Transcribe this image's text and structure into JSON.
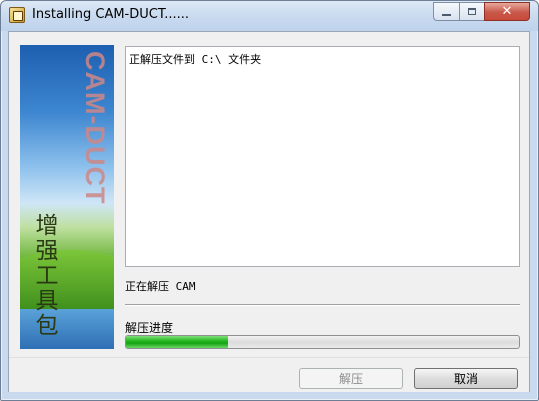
{
  "window": {
    "title": "Installing CAM-DUCT......",
    "icon": "installer-icon",
    "controls": {
      "minimize": "minimize",
      "maximize": "maximize",
      "close": "✕"
    }
  },
  "banner": {
    "brand": "CAM-DUCT",
    "subtitle": "增强工具包"
  },
  "log": {
    "lines": [
      "正解压文件到 C:\\ 文件夹"
    ]
  },
  "status": {
    "current": "正在解压 CAM"
  },
  "progress": {
    "label": "解压进度",
    "value": 0.26
  },
  "buttons": {
    "extract": "解压",
    "cancel": "取消"
  },
  "colors": {
    "progress_fill": "#1fb31a",
    "close_button": "#c94a3a"
  }
}
